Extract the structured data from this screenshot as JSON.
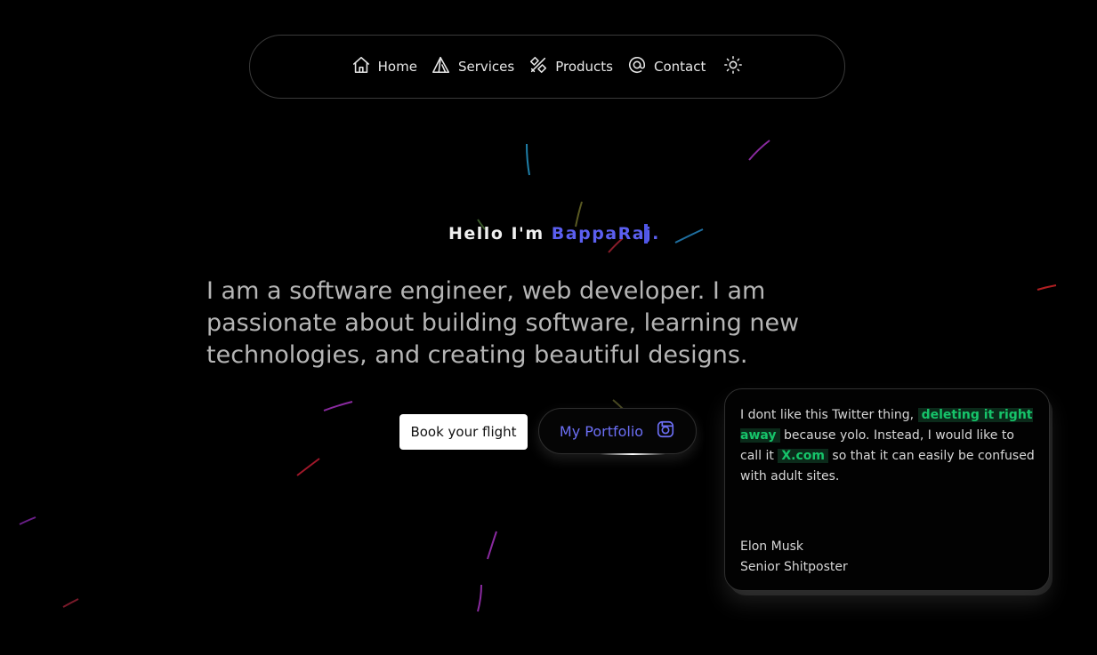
{
  "nav": {
    "items": [
      {
        "label": "Home",
        "icon": "home-icon"
      },
      {
        "label": "Services",
        "icon": "triangles-icon"
      },
      {
        "label": "Products",
        "icon": "tools-icon"
      },
      {
        "label": "Contact",
        "icon": "at-icon"
      }
    ],
    "theme_icon": "sun-icon"
  },
  "hero": {
    "greeting_prefix": "Hello I'm",
    "name": "BappaRaj.",
    "bio": "I am a software engineer, web developer. I am passionate about building software, learning new technologies, and creating beautiful designs."
  },
  "buttons": {
    "flight": "Book your flight",
    "portfolio": "My Portfolio",
    "portfolio_icon": "instagram-icon"
  },
  "quote": {
    "part1": "I dont like this Twitter thing, ",
    "highlight1": "deleting it right away",
    "part2": " because yolo. Instead, I would like to call it ",
    "highlight2": "X.com",
    "part3": " so that it can easily be confused with adult sites.",
    "author": "Elon Musk",
    "role": "Senior Shitposter"
  },
  "colors": {
    "accent": "#5b5ff0",
    "highlight": "#16c46a",
    "background": "#000000"
  }
}
